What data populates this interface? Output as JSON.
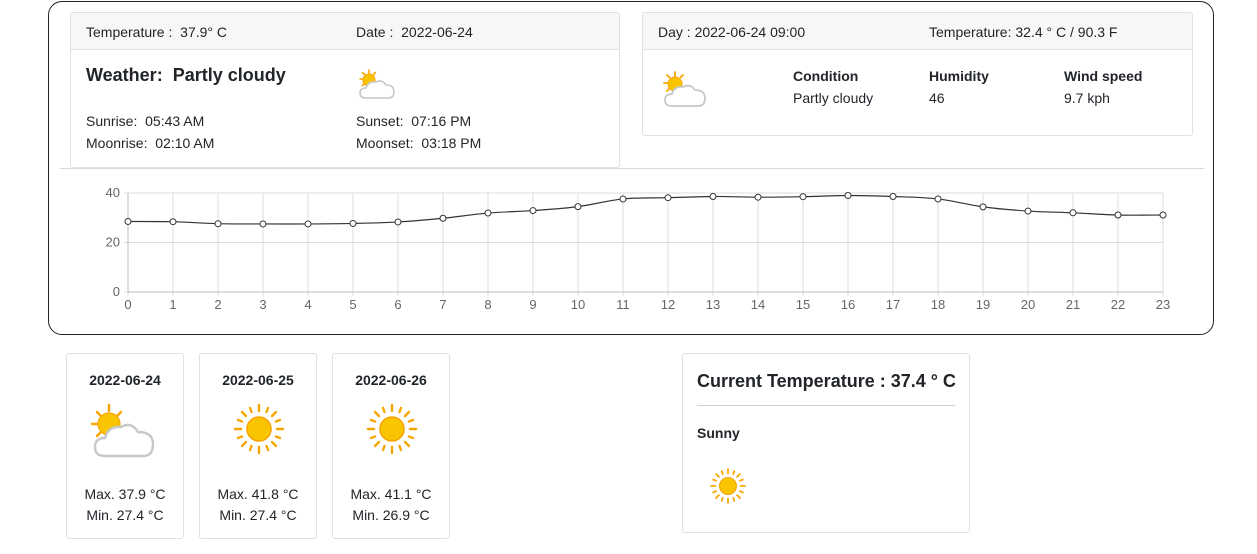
{
  "today": {
    "temperature_label": "Temperature :",
    "temperature_value": "37.9° C",
    "date_label": "Date :",
    "date_value": "2022-06-24",
    "weather_label": "Weather:",
    "weather_value": "Partly cloudy",
    "icon": "partly-cloudy-icon",
    "sunrise_label": "Sunrise:",
    "sunrise_value": "05:43 AM",
    "sunset_label": "Sunset:",
    "sunset_value": "07:16 PM",
    "moonrise_label": "Moonrise:",
    "moonrise_value": "02:10 AM",
    "moonset_label": "Moonset:",
    "moonset_value": "03:18 PM"
  },
  "hourly": {
    "day_label": "Day :",
    "day_value": "2022-06-24 09:00",
    "temperature_label": "Temperature:",
    "temperature_value": "32.4 ° C /  90.3 F",
    "icon": "partly-cloudy-icon",
    "condition_label": "Condition",
    "condition_value": "Partly cloudy",
    "humidity_label": "Humidity",
    "humidity_value": "46",
    "wind_label": "Wind speed",
    "wind_value": "9.7 kph"
  },
  "chart_data": {
    "type": "line",
    "title": "",
    "xlabel": "",
    "ylabel": "",
    "x": [
      0,
      1,
      2,
      3,
      4,
      5,
      6,
      7,
      8,
      9,
      10,
      11,
      12,
      13,
      14,
      15,
      16,
      17,
      18,
      19,
      20,
      21,
      22,
      23
    ],
    "values": [
      28.5,
      28.4,
      27.6,
      27.5,
      27.5,
      27.7,
      28.3,
      29.8,
      31.9,
      32.9,
      34.5,
      37.6,
      38.1,
      38.6,
      38.3,
      38.5,
      39.0,
      38.6,
      37.6,
      34.4,
      32.7,
      32.0,
      31.1,
      31.1
    ],
    "ylim": [
      0,
      40
    ],
    "yticks": [
      0,
      20,
      40
    ],
    "grid": true,
    "line_color": "#333333"
  },
  "forecast": [
    {
      "date": "2022-06-24",
      "max": "Max. 37.9 °C",
      "min": "Min. 27.4 °C",
      "icon": "partly-cloudy-icon"
    },
    {
      "date": "2022-06-25",
      "max": "Max. 41.8 °C",
      "min": "Min. 27.4 °C",
      "icon": "sunny-icon"
    },
    {
      "date": "2022-06-26",
      "max": "Max. 41.1 °C",
      "min": "Min. 26.9 °C",
      "icon": "sunny-icon"
    }
  ],
  "current": {
    "title": "Current Temperature :  37.4 ° C",
    "condition": "Sunny",
    "icon": "sunny-icon"
  },
  "colors": {
    "sun": "#f9c400",
    "sun_ray": "#f7a600",
    "cloud_stroke": "#c8c8c8",
    "border": "#dee2e6"
  }
}
